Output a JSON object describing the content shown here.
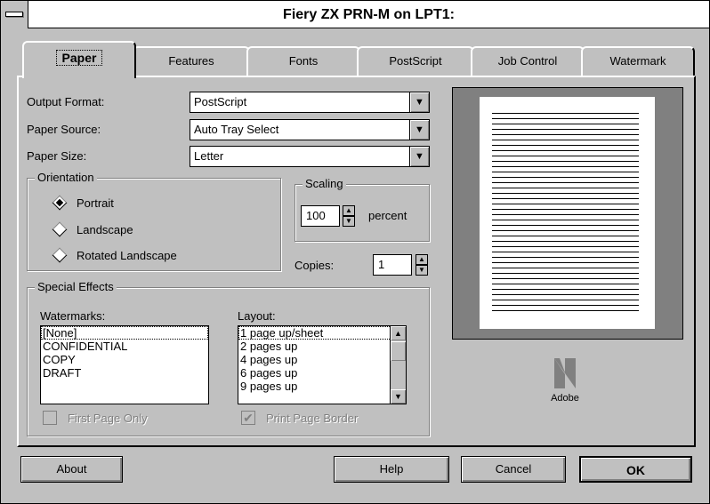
{
  "window": {
    "title": "Fiery ZX PRN-M on LPT1:"
  },
  "tabs": [
    {
      "label": "Paper",
      "active": true
    },
    {
      "label": "Features"
    },
    {
      "label": "Fonts"
    },
    {
      "label": "PostScript"
    },
    {
      "label": "Job Control"
    },
    {
      "label": "Watermark"
    }
  ],
  "paper": {
    "output_format_label": "Output Format:",
    "output_format_value": "PostScript",
    "paper_source_label": "Paper Source:",
    "paper_source_value": "Auto Tray Select",
    "paper_size_label": "Paper Size:",
    "paper_size_value": "Letter",
    "orientation": {
      "title": "Orientation",
      "options": [
        "Portrait",
        "Landscape",
        "Rotated Landscape"
      ],
      "selected": "Portrait"
    },
    "scaling": {
      "title": "Scaling",
      "value": "100",
      "unit": "percent"
    },
    "copies": {
      "label": "Copies:",
      "value": "1"
    },
    "special_effects": {
      "title": "Special Effects",
      "watermarks_label": "Watermarks:",
      "watermarks": [
        "[None]",
        "CONFIDENTIAL",
        "COPY",
        "DRAFT"
      ],
      "layout_label": "Layout:",
      "layout": [
        "1 page up/sheet",
        "2 pages up",
        "4 pages up",
        "6 pages up",
        "9 pages up"
      ],
      "first_page_only": "First Page Only",
      "print_page_border": "Print Page Border"
    },
    "logo_text": "Adobe"
  },
  "buttons": {
    "about": "About",
    "help": "Help",
    "cancel": "Cancel",
    "ok": "OK"
  }
}
